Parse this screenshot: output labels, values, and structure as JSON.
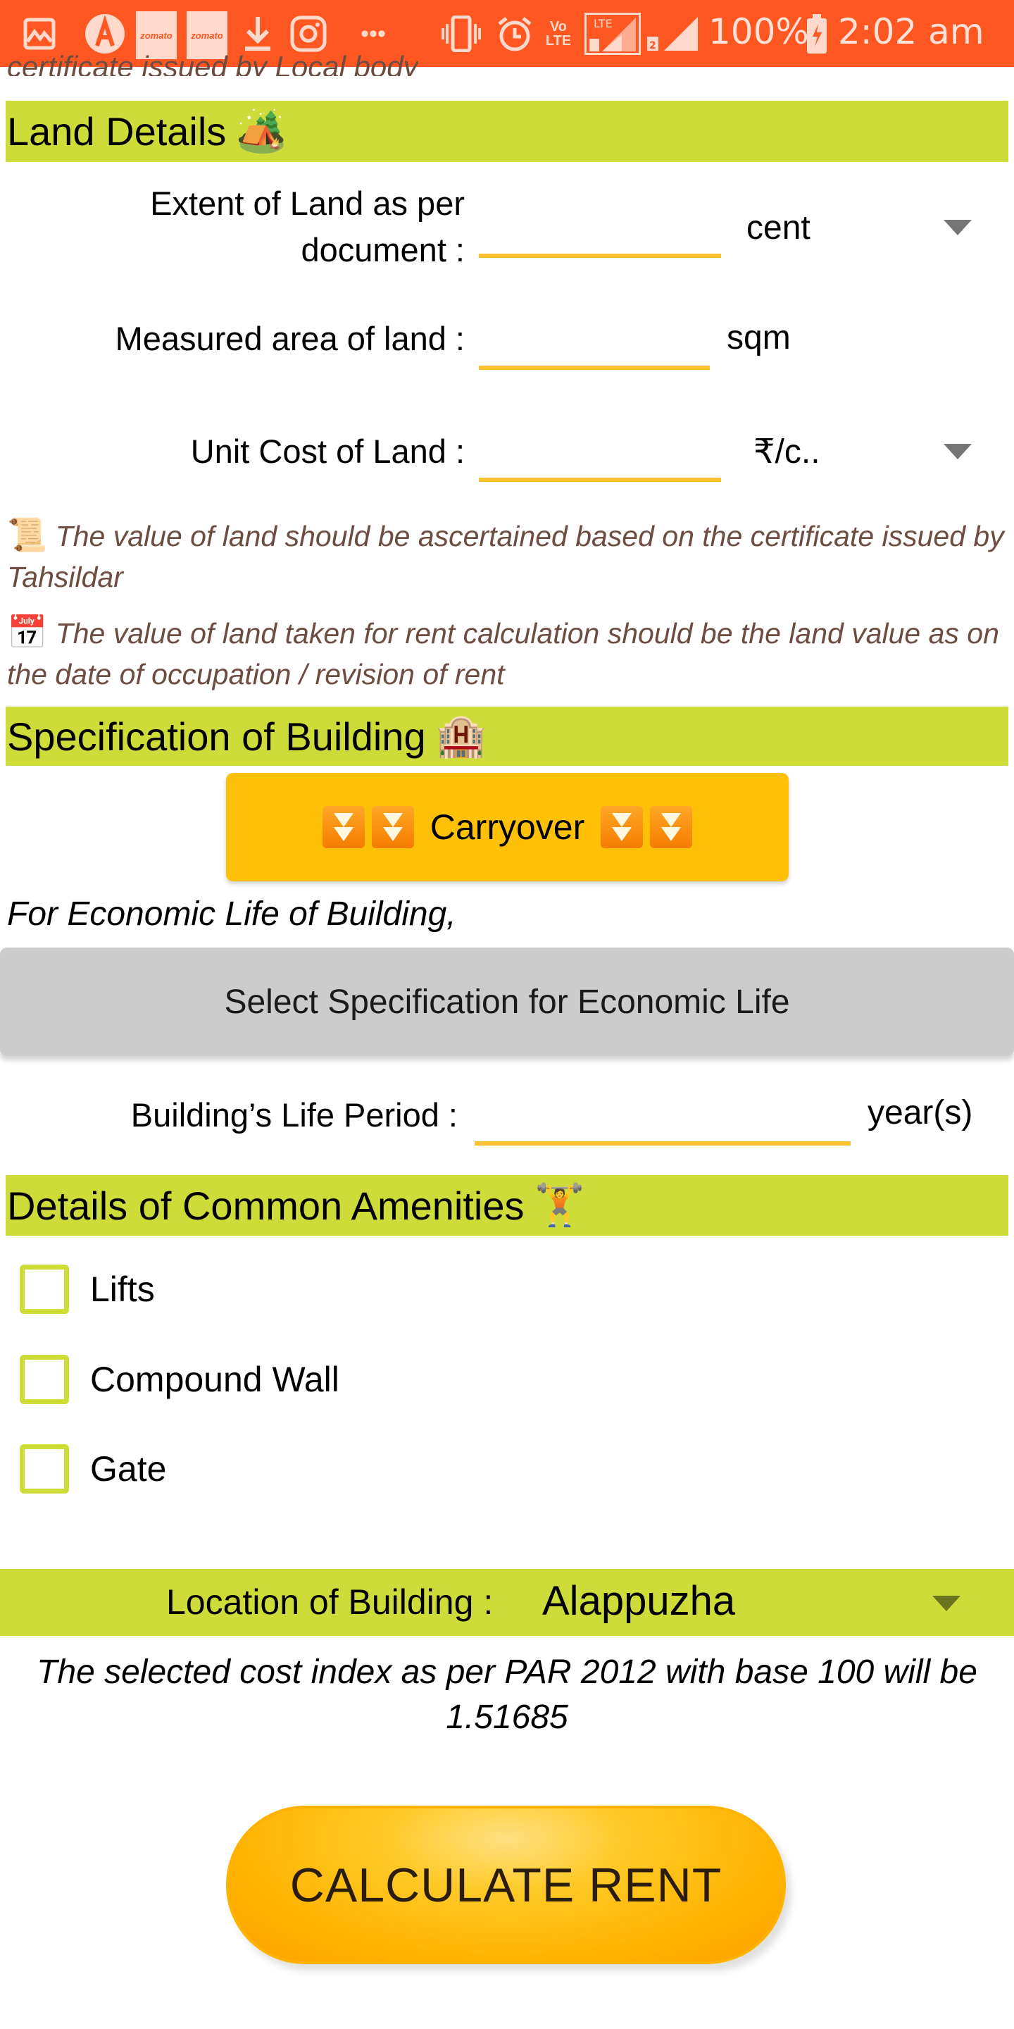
{
  "status_bar": {
    "left_icons": [
      "gallery-icon",
      "a-app-icon",
      "zomato-icon",
      "zomato-icon",
      "download-icon",
      "instagram-icon",
      "more-icon"
    ],
    "zomato_label": "zomato",
    "more_glyph": "•••",
    "right_icons": [
      "vibrate-icon",
      "alarm-icon",
      "volte-icon",
      "lte-sim1-signal-icon",
      "sim2-signal-icon",
      "battery-charging-icon"
    ],
    "volte_label": "Vo\nLTE",
    "battery": "100%",
    "time": "2:02 am"
  },
  "cutoff_text": "certificate issued by Local body",
  "land_details": {
    "title": "Land Details",
    "emoji": "🏕️",
    "extent_label_line1": "Extent of Land as per",
    "extent_label_line2": "document :",
    "extent_value": "",
    "extent_unit": "cent",
    "measured_label": "Measured area of land :",
    "measured_value": "",
    "measured_unit": "sqm",
    "unit_cost_label": "Unit Cost of Land :",
    "unit_cost_value": "",
    "unit_cost_unit": "₹/c.."
  },
  "notes": [
    {
      "emoji": "📜",
      "text": "The value of land should be ascertained based on the certificate issued by Tahsildar"
    },
    {
      "emoji": "📅",
      "text": "The value of land taken for rent calculation should be the land value as on the date of occupation / revision of rent"
    }
  ],
  "building": {
    "title": "Specification of Building",
    "emoji": "🏨",
    "carryover_label": "Carryover",
    "for_econ_text": "For Economic Life of Building,",
    "select_spec_label": "Select Specification for Economic Life",
    "life_period_label": "Building’s Life Period :",
    "life_period_value": "",
    "life_period_unit": "year(s)"
  },
  "amenities": {
    "title": "Details of Common Amenities",
    "emoji": "🏋️",
    "items": [
      {
        "label": "Lifts",
        "checked": false
      },
      {
        "label": "Compound Wall",
        "checked": false
      },
      {
        "label": "Gate",
        "checked": false
      }
    ]
  },
  "location": {
    "label": "Location of Building :",
    "value": "Alappuzha",
    "cost_index_note": "The selected cost index as per PAR 2012 with base 100 will be 1.51685"
  },
  "calculate_label": "CALCULATE RENT",
  "colors": {
    "status_bar": "#ff5722",
    "section_band": "#cddc39",
    "field_underline": "#fbc02d",
    "carryover_button": "#ffc107",
    "note_text": "#6d4c41",
    "gray_button": "#cccccc"
  }
}
